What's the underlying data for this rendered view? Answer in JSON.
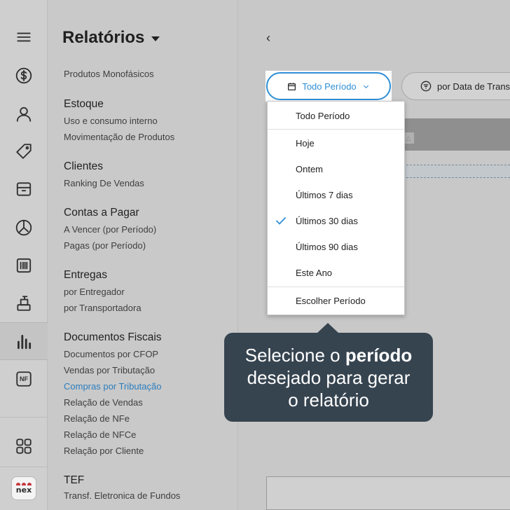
{
  "rail": {
    "icons": [
      "menu-icon",
      "dollar-icon",
      "user-icon",
      "tag-icon",
      "box-icon",
      "pie-chart-icon",
      "barcode-icon",
      "register-icon",
      "bar-chart-icon",
      "nfe-icon",
      "apps-grid-icon"
    ],
    "nfe_label": "NF",
    "logo_text": "nex"
  },
  "menu": {
    "title": "Relatórios",
    "partial_item": "Produtos Monofásicos",
    "sections": [
      {
        "heading": "Estoque",
        "items": [
          "Uso e consumo interno",
          "Movimentação de Produtos"
        ]
      },
      {
        "heading": "Clientes",
        "items": [
          "Ranking De Vendas"
        ]
      },
      {
        "heading": "Contas a Pagar",
        "items": [
          "A Vencer (por Período)",
          "Pagas (por Período)"
        ]
      },
      {
        "heading": "Entregas",
        "items": [
          "por Entregador",
          "por Transportadora"
        ]
      },
      {
        "heading": "Documentos Fiscais",
        "items": [
          "Documentos por CFOP",
          "Vendas por Tributação",
          "Compras por Tributação",
          "Relação de Vendas",
          "Relação de NFe",
          "Relação de NFCe",
          "Relação por Cliente"
        ]
      },
      {
        "heading": "TEF",
        "items": [
          "Transf. Eletronica de Fundos"
        ]
      }
    ]
  },
  "toolbar": {
    "back": "‹",
    "period_label": "Todo Período",
    "date_filter_label": "por Data de Transação"
  },
  "dropdown": {
    "items": [
      "Todo Período",
      "Hoje",
      "Ontem",
      "Últimos 7 dias",
      "Últimos 30 dias",
      "Últimos 90 dias",
      "Este Ano",
      "Escolher Período"
    ],
    "selected": "Últimos 30 dias",
    "check_color": "#2f8fd6"
  },
  "tooltip": {
    "line1_pre": "Selecione o ",
    "line1_bold": "período",
    "line2": "desejado para gerar",
    "line3": "o relatório"
  },
  "colors": {
    "accent": "#2f8fd6",
    "link": "#2b7dbd",
    "tooltip_bg": "#364450",
    "brand_red": "#c7373d"
  }
}
